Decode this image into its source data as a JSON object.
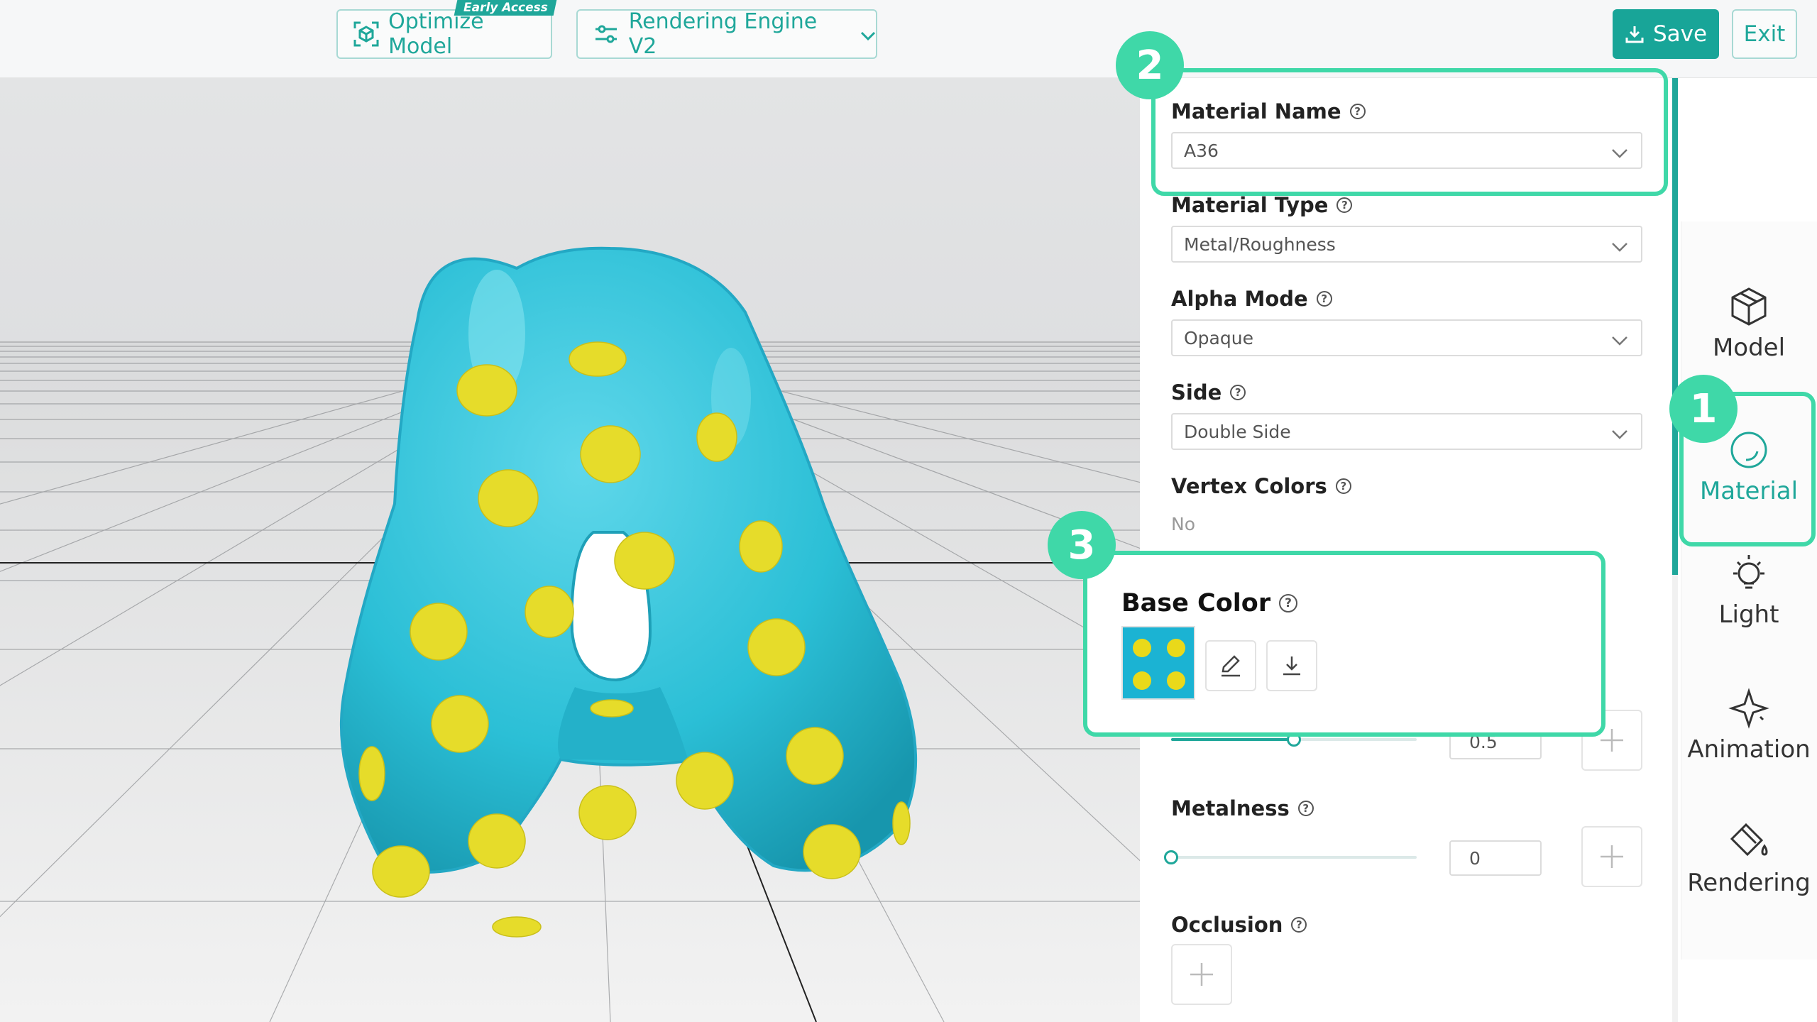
{
  "topbar": {
    "optimize_label": "Optimize Model",
    "early_access": "Early Access",
    "engine_label": "Rendering Engine V2",
    "save_label": "Save",
    "exit_label": "Exit"
  },
  "panel": {
    "material_name": {
      "label": "Material Name",
      "value": "A36"
    },
    "material_type": {
      "label": "Material Type",
      "value": "Metal/Roughness"
    },
    "alpha_mode": {
      "label": "Alpha Mode",
      "value": "Opaque"
    },
    "side": {
      "label": "Side",
      "value": "Double Side"
    },
    "vertex_colors": {
      "label": "Vertex Colors",
      "value": "No"
    },
    "base_color": {
      "label": "Base Color"
    },
    "roughness": {
      "value": "0.5",
      "fraction": 0.5
    },
    "metalness": {
      "label": "Metalness",
      "value": "0",
      "fraction": 0
    },
    "occlusion": {
      "label": "Occlusion"
    }
  },
  "callouts": {
    "one": "1",
    "two": "2",
    "three": "3"
  },
  "sidebar": {
    "items": [
      {
        "label": "Model",
        "icon": "cube-icon"
      },
      {
        "label": "Material",
        "icon": "sphere-icon",
        "active": true
      },
      {
        "label": "Light",
        "icon": "lightbulb-icon"
      },
      {
        "label": "Animation",
        "icon": "sparkle-icon"
      },
      {
        "label": "Rendering",
        "icon": "paint-bucket-icon"
      }
    ]
  },
  "colors": {
    "accent": "#1fa79a",
    "callout": "#3fd8a8",
    "model_body": "#2bbfd6",
    "model_dots": "#e6dc2a"
  }
}
